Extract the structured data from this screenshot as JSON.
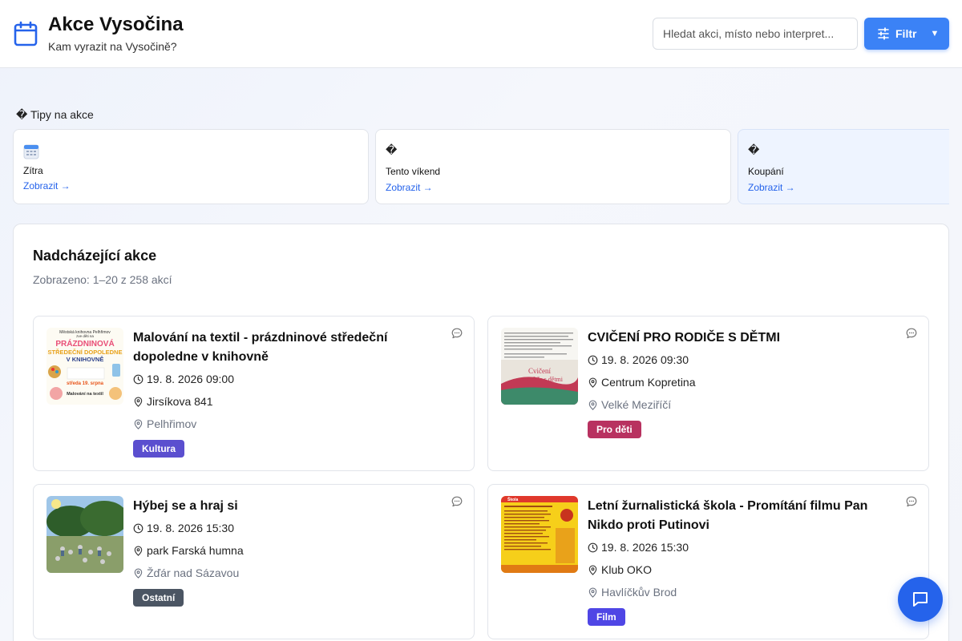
{
  "header": {
    "title": "Akce Vysočina",
    "subtitle": "Kam vyrazit na Vysočině?",
    "search_placeholder": "Hledat akci, místo nebo interpret...",
    "filter_label": "Filtr",
    "filter_caret": "▼"
  },
  "tips": {
    "heading": "� Tipy na akce",
    "items": [
      {
        "label": "Zítra",
        "link": "Zobrazit →",
        "icon": "calendar-icon"
      },
      {
        "label": "Tento víkend",
        "link": "Zobrazit →",
        "icon": "missing-glyph-icon",
        "icon_glyph": "�"
      },
      {
        "label": "Koupání",
        "link": "Zobrazit →",
        "icon": "missing-glyph-icon",
        "icon_glyph": "�"
      }
    ]
  },
  "events_panel": {
    "title": "Nadcházející akce",
    "subtitle": "Zobrazeno: 1–20 z 258 akcí"
  },
  "events": [
    {
      "title": "Malování na textil - prázdninové středeční dopoledne v knihovně",
      "datetime": "19. 8. 2026 09:00",
      "venue": "Jirsíkova 841",
      "city": "Pelhřimov",
      "category": "Kultura",
      "category_color": "#5b4fcf",
      "thumb_texts": [
        "Městská knihovna Pelhřimov",
        "zve děti na",
        "PRÁZDNINOVÁ",
        "STŘEDEČNÍ DOPOLEDNE",
        "V KNIHOVNĚ",
        "středa 19. srpna",
        "Malování na textil"
      ]
    },
    {
      "title": "CVIČENÍ PRO RODIČE S DĚTMI",
      "datetime": "19. 8. 2026 09:30",
      "venue": "Centrum Kopretina",
      "city": "Velké Meziříčí",
      "category": "Pro děti",
      "category_color": "#b83260",
      "thumb_texts": [
        "Cvičení",
        "pro rodiče s dětmi"
      ]
    },
    {
      "title": "Hýbej se a hraj si",
      "datetime": "19. 8. 2026 15:30",
      "venue": "park Farská humna",
      "city": "Žďár nad Sázavou",
      "category": "Ostatní",
      "category_color": "#4b5563",
      "thumb_texts": []
    },
    {
      "title": "Letní žurnalistická škola - Promítání filmu Pan Nikdo proti Putinovi",
      "datetime": "19. 8. 2026 15:30",
      "venue": "Klub OKO",
      "city": "Havlíčkův Brod",
      "category": "Film",
      "category_color": "#4f46e5",
      "thumb_texts": [
        "Škola"
      ]
    }
  ],
  "colors": {
    "accent": "#3b82f6",
    "link": "#2563eb",
    "fab": "#2563eb"
  }
}
